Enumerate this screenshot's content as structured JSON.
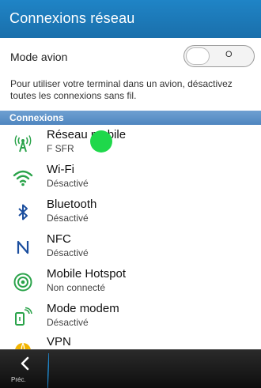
{
  "header": {
    "title": "Connexions réseau"
  },
  "airplane": {
    "label": "Mode avion",
    "toggle_state": "O"
  },
  "hint": "Pour utiliser votre terminal dans un avion, désactivez toutes les connexions sans fil.",
  "section": {
    "label": "Connexions"
  },
  "items": [
    {
      "title": "Réseau mobile",
      "subtitle": "F SFR",
      "icon": "cellular-antenna-icon"
    },
    {
      "title": "Wi-Fi",
      "subtitle": "Désactivé",
      "icon": "wifi-icon"
    },
    {
      "title": "Bluetooth",
      "subtitle": "Désactivé",
      "icon": "bluetooth-icon"
    },
    {
      "title": "NFC",
      "subtitle": "Désactivé",
      "icon": "nfc-icon"
    },
    {
      "title": "Mobile Hotspot",
      "subtitle": "Non connecté",
      "icon": "hotspot-icon"
    },
    {
      "title": "Mode modem",
      "subtitle": "Désactivé",
      "icon": "tethering-icon"
    },
    {
      "title": "VPN",
      "subtitle": "",
      "icon": "vpn-icon"
    }
  ],
  "bottom_bar": {
    "back_label": "Préc."
  },
  "colors": {
    "header": "#1a74b6",
    "accent_green": "#2aa34a",
    "section": "#5a8fc6"
  }
}
